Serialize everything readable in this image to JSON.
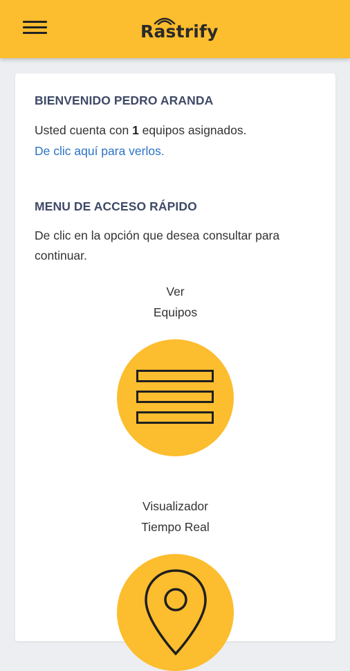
{
  "app": {
    "brand_name": "Rastrify",
    "brand_color": "#fcbd2e",
    "menu_icon": "hamburger-menu-icon"
  },
  "welcome": {
    "title": "BIENVENIDO PEDRO ARANDA",
    "assigned_prefix": "Usted cuenta con ",
    "assigned_count": "1",
    "assigned_suffix": " equipos asignados.",
    "link_text": "De clic aquí para verlos."
  },
  "quick_menu": {
    "title": "MENU DE ACCESO RÁPIDO",
    "instruction": "De clic en la opción que desea consultar para continuar.",
    "options": [
      {
        "line1": "Ver",
        "line2": "Equipos",
        "icon": "list-icon"
      },
      {
        "line1": "Visualizador",
        "line2": "Tiempo Real",
        "icon": "location-pin-icon"
      }
    ]
  }
}
